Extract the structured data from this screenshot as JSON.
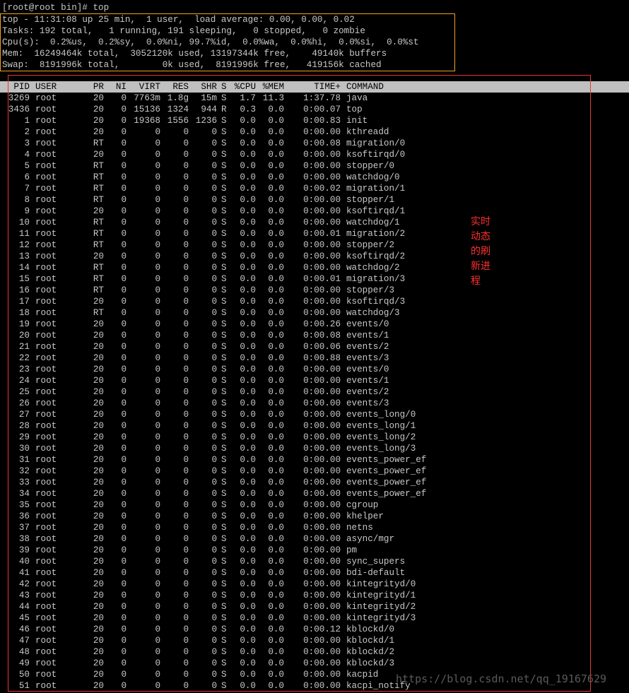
{
  "terminal": {
    "prompt_line": "[root@root bin]# top",
    "summary": [
      "top - 11:31:08 up 25 min,  1 user,  load average: 0.00, 0.00, 0.02",
      "Tasks: 192 total,   1 running, 191 sleeping,   0 stopped,   0 zombie",
      "Cpu(s):  0.2%us,  0.2%sy,  0.0%ni, 99.7%id,  0.0%wa,  0.0%hi,  0.0%si,  0.0%st",
      "Mem:  16249464k total,  3052120k used, 13197344k free,    49140k buffers",
      "Swap:  8191996k total,        0k used,  8191996k free,   419156k cached"
    ],
    "columns": [
      "PID",
      "USER",
      "PR",
      "NI",
      "VIRT",
      "RES",
      "SHR",
      "S",
      "%CPU",
      "%MEM",
      "TIME+",
      "COMMAND"
    ],
    "processes": [
      [
        "3269",
        "root",
        "20",
        "0",
        "7763m",
        "1.8g",
        "15m",
        "S",
        "1.7",
        "11.3",
        "1:37.78",
        "java"
      ],
      [
        "3436",
        "root",
        "20",
        "0",
        "15136",
        "1324",
        "944",
        "R",
        "0.3",
        "0.0",
        "0:00.07",
        "top"
      ],
      [
        "1",
        "root",
        "20",
        "0",
        "19368",
        "1556",
        "1236",
        "S",
        "0.0",
        "0.0",
        "0:00.83",
        "init"
      ],
      [
        "2",
        "root",
        "20",
        "0",
        "0",
        "0",
        "0",
        "S",
        "0.0",
        "0.0",
        "0:00.00",
        "kthreadd"
      ],
      [
        "3",
        "root",
        "RT",
        "0",
        "0",
        "0",
        "0",
        "S",
        "0.0",
        "0.0",
        "0:00.08",
        "migration/0"
      ],
      [
        "4",
        "root",
        "20",
        "0",
        "0",
        "0",
        "0",
        "S",
        "0.0",
        "0.0",
        "0:00.00",
        "ksoftirqd/0"
      ],
      [
        "5",
        "root",
        "RT",
        "0",
        "0",
        "0",
        "0",
        "S",
        "0.0",
        "0.0",
        "0:00.00",
        "stopper/0"
      ],
      [
        "6",
        "root",
        "RT",
        "0",
        "0",
        "0",
        "0",
        "S",
        "0.0",
        "0.0",
        "0:00.00",
        "watchdog/0"
      ],
      [
        "7",
        "root",
        "RT",
        "0",
        "0",
        "0",
        "0",
        "S",
        "0.0",
        "0.0",
        "0:00.02",
        "migration/1"
      ],
      [
        "8",
        "root",
        "RT",
        "0",
        "0",
        "0",
        "0",
        "S",
        "0.0",
        "0.0",
        "0:00.00",
        "stopper/1"
      ],
      [
        "9",
        "root",
        "20",
        "0",
        "0",
        "0",
        "0",
        "S",
        "0.0",
        "0.0",
        "0:00.00",
        "ksoftirqd/1"
      ],
      [
        "10",
        "root",
        "RT",
        "0",
        "0",
        "0",
        "0",
        "S",
        "0.0",
        "0.0",
        "0:00.00",
        "watchdog/1"
      ],
      [
        "11",
        "root",
        "RT",
        "0",
        "0",
        "0",
        "0",
        "S",
        "0.0",
        "0.0",
        "0:00.01",
        "migration/2"
      ],
      [
        "12",
        "root",
        "RT",
        "0",
        "0",
        "0",
        "0",
        "S",
        "0.0",
        "0.0",
        "0:00.00",
        "stopper/2"
      ],
      [
        "13",
        "root",
        "20",
        "0",
        "0",
        "0",
        "0",
        "S",
        "0.0",
        "0.0",
        "0:00.00",
        "ksoftirqd/2"
      ],
      [
        "14",
        "root",
        "RT",
        "0",
        "0",
        "0",
        "0",
        "S",
        "0.0",
        "0.0",
        "0:00.00",
        "watchdog/2"
      ],
      [
        "15",
        "root",
        "RT",
        "0",
        "0",
        "0",
        "0",
        "S",
        "0.0",
        "0.0",
        "0:00.01",
        "migration/3"
      ],
      [
        "16",
        "root",
        "RT",
        "0",
        "0",
        "0",
        "0",
        "S",
        "0.0",
        "0.0",
        "0:00.00",
        "stopper/3"
      ],
      [
        "17",
        "root",
        "20",
        "0",
        "0",
        "0",
        "0",
        "S",
        "0.0",
        "0.0",
        "0:00.00",
        "ksoftirqd/3"
      ],
      [
        "18",
        "root",
        "RT",
        "0",
        "0",
        "0",
        "0",
        "S",
        "0.0",
        "0.0",
        "0:00.00",
        "watchdog/3"
      ],
      [
        "19",
        "root",
        "20",
        "0",
        "0",
        "0",
        "0",
        "S",
        "0.0",
        "0.0",
        "0:00.26",
        "events/0"
      ],
      [
        "20",
        "root",
        "20",
        "0",
        "0",
        "0",
        "0",
        "S",
        "0.0",
        "0.0",
        "0:00.08",
        "events/1"
      ],
      [
        "21",
        "root",
        "20",
        "0",
        "0",
        "0",
        "0",
        "S",
        "0.0",
        "0.0",
        "0:00.06",
        "events/2"
      ],
      [
        "22",
        "root",
        "20",
        "0",
        "0",
        "0",
        "0",
        "S",
        "0.0",
        "0.0",
        "0:00.88",
        "events/3"
      ],
      [
        "23",
        "root",
        "20",
        "0",
        "0",
        "0",
        "0",
        "S",
        "0.0",
        "0.0",
        "0:00.00",
        "events/0"
      ],
      [
        "24",
        "root",
        "20",
        "0",
        "0",
        "0",
        "0",
        "S",
        "0.0",
        "0.0",
        "0:00.00",
        "events/1"
      ],
      [
        "25",
        "root",
        "20",
        "0",
        "0",
        "0",
        "0",
        "S",
        "0.0",
        "0.0",
        "0:00.00",
        "events/2"
      ],
      [
        "26",
        "root",
        "20",
        "0",
        "0",
        "0",
        "0",
        "S",
        "0.0",
        "0.0",
        "0:00.00",
        "events/3"
      ],
      [
        "27",
        "root",
        "20",
        "0",
        "0",
        "0",
        "0",
        "S",
        "0.0",
        "0.0",
        "0:00.00",
        "events_long/0"
      ],
      [
        "28",
        "root",
        "20",
        "0",
        "0",
        "0",
        "0",
        "S",
        "0.0",
        "0.0",
        "0:00.00",
        "events_long/1"
      ],
      [
        "29",
        "root",
        "20",
        "0",
        "0",
        "0",
        "0",
        "S",
        "0.0",
        "0.0",
        "0:00.00",
        "events_long/2"
      ],
      [
        "30",
        "root",
        "20",
        "0",
        "0",
        "0",
        "0",
        "S",
        "0.0",
        "0.0",
        "0:00.00",
        "events_long/3"
      ],
      [
        "31",
        "root",
        "20",
        "0",
        "0",
        "0",
        "0",
        "S",
        "0.0",
        "0.0",
        "0:00.00",
        "events_power_ef"
      ],
      [
        "32",
        "root",
        "20",
        "0",
        "0",
        "0",
        "0",
        "S",
        "0.0",
        "0.0",
        "0:00.00",
        "events_power_ef"
      ],
      [
        "33",
        "root",
        "20",
        "0",
        "0",
        "0",
        "0",
        "S",
        "0.0",
        "0.0",
        "0:00.00",
        "events_power_ef"
      ],
      [
        "34",
        "root",
        "20",
        "0",
        "0",
        "0",
        "0",
        "S",
        "0.0",
        "0.0",
        "0:00.00",
        "events_power_ef"
      ],
      [
        "35",
        "root",
        "20",
        "0",
        "0",
        "0",
        "0",
        "S",
        "0.0",
        "0.0",
        "0:00.00",
        "cgroup"
      ],
      [
        "36",
        "root",
        "20",
        "0",
        "0",
        "0",
        "0",
        "S",
        "0.0",
        "0.0",
        "0:00.00",
        "khelper"
      ],
      [
        "37",
        "root",
        "20",
        "0",
        "0",
        "0",
        "0",
        "S",
        "0.0",
        "0.0",
        "0:00.00",
        "netns"
      ],
      [
        "38",
        "root",
        "20",
        "0",
        "0",
        "0",
        "0",
        "S",
        "0.0",
        "0.0",
        "0:00.00",
        "async/mgr"
      ],
      [
        "39",
        "root",
        "20",
        "0",
        "0",
        "0",
        "0",
        "S",
        "0.0",
        "0.0",
        "0:00.00",
        "pm"
      ],
      [
        "40",
        "root",
        "20",
        "0",
        "0",
        "0",
        "0",
        "S",
        "0.0",
        "0.0",
        "0:00.00",
        "sync_supers"
      ],
      [
        "41",
        "root",
        "20",
        "0",
        "0",
        "0",
        "0",
        "S",
        "0.0",
        "0.0",
        "0:00.00",
        "bdi-default"
      ],
      [
        "42",
        "root",
        "20",
        "0",
        "0",
        "0",
        "0",
        "S",
        "0.0",
        "0.0",
        "0:00.00",
        "kintegrityd/0"
      ],
      [
        "43",
        "root",
        "20",
        "0",
        "0",
        "0",
        "0",
        "S",
        "0.0",
        "0.0",
        "0:00.00",
        "kintegrityd/1"
      ],
      [
        "44",
        "root",
        "20",
        "0",
        "0",
        "0",
        "0",
        "S",
        "0.0",
        "0.0",
        "0:00.00",
        "kintegrityd/2"
      ],
      [
        "45",
        "root",
        "20",
        "0",
        "0",
        "0",
        "0",
        "S",
        "0.0",
        "0.0",
        "0:00.00",
        "kintegrityd/3"
      ],
      [
        "46",
        "root",
        "20",
        "0",
        "0",
        "0",
        "0",
        "S",
        "0.0",
        "0.0",
        "0:00.12",
        "kblockd/0"
      ],
      [
        "47",
        "root",
        "20",
        "0",
        "0",
        "0",
        "0",
        "S",
        "0.0",
        "0.0",
        "0:00.00",
        "kblockd/1"
      ],
      [
        "48",
        "root",
        "20",
        "0",
        "0",
        "0",
        "0",
        "S",
        "0.0",
        "0.0",
        "0:00.00",
        "kblockd/2"
      ],
      [
        "49",
        "root",
        "20",
        "0",
        "0",
        "0",
        "0",
        "S",
        "0.0",
        "0.0",
        "0:00.00",
        "kblockd/3"
      ],
      [
        "50",
        "root",
        "20",
        "0",
        "0",
        "0",
        "0",
        "S",
        "0.0",
        "0.0",
        "0:00.00",
        "kacpid"
      ],
      [
        "51",
        "root",
        "20",
        "0",
        "0",
        "0",
        "0",
        "S",
        "0.0",
        "0.0",
        "0:00.00",
        "kacpi_notify"
      ]
    ]
  },
  "annotation": {
    "text": "实时动态的刷新进程",
    "color": "#ff3030"
  },
  "watermark": "https://blog.csdn.net/qq_19167629",
  "colors": {
    "background": "#000000",
    "text": "#c8c8c8",
    "header_bar": "#c0c0c0",
    "summary_box": "#f2a21c",
    "process_box": "#e53935"
  }
}
